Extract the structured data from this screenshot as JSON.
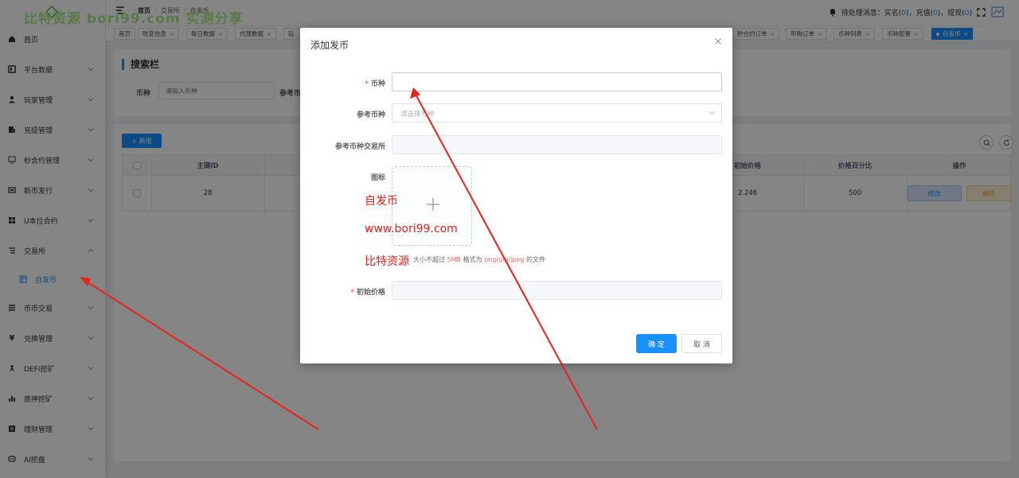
{
  "watermark": {
    "top": "比特资源 bori99.com 实测分享",
    "red_line1": "自发币",
    "red_line2": "www.bori99.com",
    "red_line3": "比特资源"
  },
  "sidebar": {
    "items": [
      {
        "label": "首页",
        "icon": "home-icon"
      },
      {
        "label": "平台数据",
        "icon": "chart-icon"
      },
      {
        "label": "玩家管理",
        "icon": "user-icon"
      },
      {
        "label": "充提管理",
        "icon": "wallet-icon"
      },
      {
        "label": "秒合约管理",
        "icon": "contract-icon"
      },
      {
        "label": "新币发行",
        "icon": "coin-icon"
      },
      {
        "label": "U本位合约",
        "icon": "grid-icon"
      },
      {
        "label": "交易所",
        "icon": "exchange-icon"
      },
      {
        "label": "自发币",
        "icon": "table-icon"
      },
      {
        "label": "币币交易",
        "icon": "list-icon"
      },
      {
        "label": "兑换管理",
        "icon": "yen-icon"
      },
      {
        "label": "DEFI挖矿",
        "icon": "miner-icon"
      },
      {
        "label": "质押挖矿",
        "icon": "bar-chart-icon"
      },
      {
        "label": "理财管理",
        "icon": "finance-icon"
      },
      {
        "label": "AI挖盘",
        "icon": "robot-icon"
      }
    ]
  },
  "topbar": {
    "breadcrumb": [
      "首页",
      "交易所",
      "自发币"
    ],
    "notice_prefix": "待处理消息：实名(",
    "notice_a": "0",
    "notice_mid1": ")，充值(",
    "notice_b": "0",
    "notice_mid2": ")，提现(",
    "notice_c": "0",
    "notice_suffix": ")"
  },
  "tags": [
    {
      "label": "首页",
      "closable": false
    },
    {
      "label": "账变信息"
    },
    {
      "label": "每日数据"
    },
    {
      "label": "代理数据"
    },
    {
      "label": "玩"
    },
    {
      "label": "秒合约订单"
    },
    {
      "label": "申购订单"
    },
    {
      "label": "币种列表"
    },
    {
      "label": "币种配置"
    },
    {
      "label": "自发币",
      "active": true
    }
  ],
  "search": {
    "title": "搜索栏",
    "label_coin": "币种",
    "placeholder_coin": "请输入币种",
    "label_ref": "参考币"
  },
  "table": {
    "add_label": "+ 新增",
    "headers": {
      "id": "主键ID",
      "init_price": "初始价格",
      "percent": "价格百分比",
      "ops": "操作"
    },
    "rows": [
      {
        "id": "28",
        "init_price": "2.246",
        "percent": "500",
        "edit": "修改",
        "delete": "删除"
      }
    ]
  },
  "dialog": {
    "title": "添加发币",
    "label_coin": "币种",
    "label_ref_coin": "参考币种",
    "placeholder_ref_coin": "请选择币种",
    "label_ref_exchange": "参考币种交易所",
    "label_icon": "图标",
    "hint_pre": "大小不超过",
    "hint_size": "5MB",
    "hint_mid": "格式为",
    "hint_format": "png/jpg/jpeg",
    "hint_post": "的文件",
    "label_init_price": "初始价格",
    "ok_label": "确 定",
    "cancel_label": "取 消"
  },
  "colors": {
    "primary": "#1890ff",
    "required": "#f56c6c",
    "arrow": "#e8231b"
  }
}
